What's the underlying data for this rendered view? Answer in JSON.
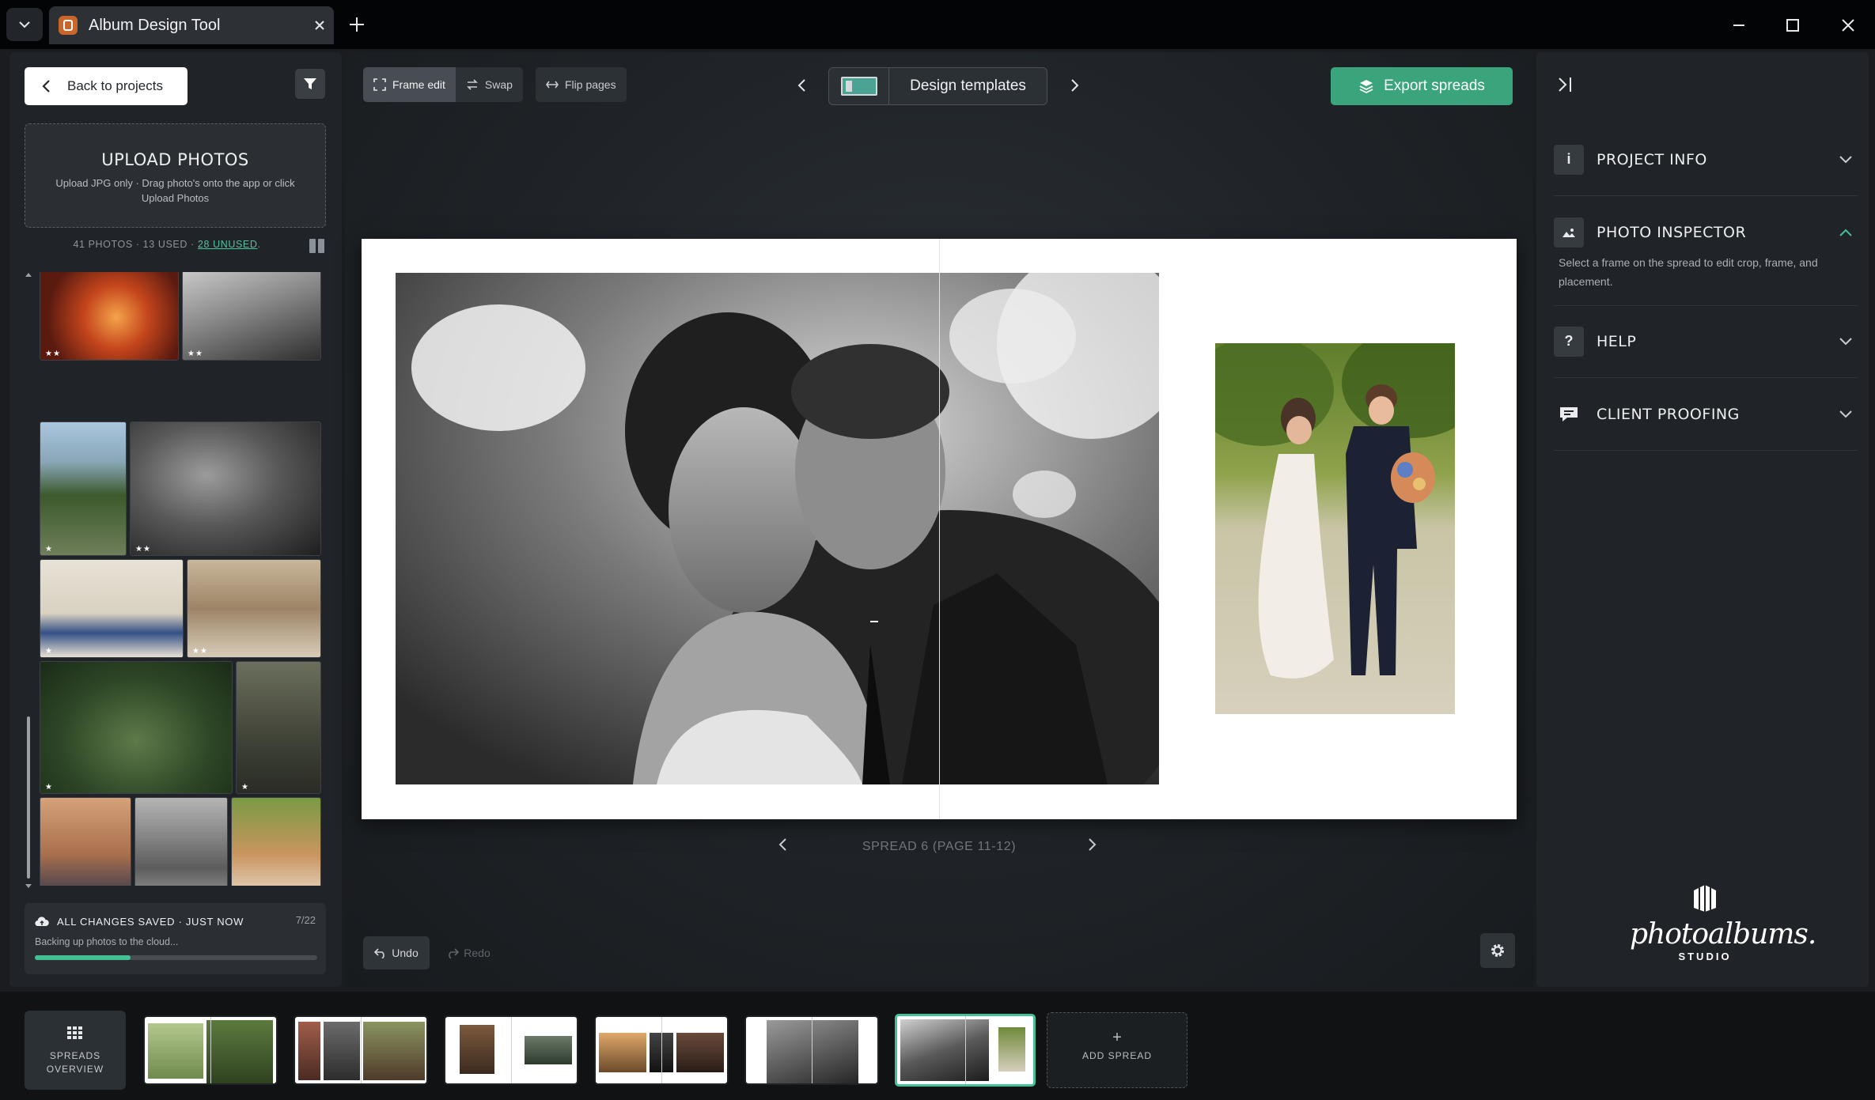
{
  "window": {
    "tab_title": "Album Design Tool"
  },
  "left_panel": {
    "back_label": "Back to projects",
    "upload_title": "UPLOAD PHOTOS",
    "upload_sub": "Upload JPG only · Drag photo's onto the app or click Upload Photos",
    "stats_prefix": "41 PHOTOS · 13 USED · ",
    "stats_unused": "28 UNUSED",
    "stats_suffix": ".",
    "save_title": "ALL CHANGES SAVED · JUST NOW",
    "save_count": "7/22",
    "save_sub": "Backing up photos to the cloud...",
    "save_progress": 0.34
  },
  "toolbar": {
    "frame_edit": "Frame edit",
    "swap": "Swap",
    "flip_pages": "Flip pages",
    "templates_label": "Design templates",
    "export_label": "Export spreads"
  },
  "canvas": {
    "spread_label": "SPREAD 6 (PAGE 11-12)",
    "undo_label": "Undo",
    "redo_label": "Redo"
  },
  "right_panel": {
    "sections": [
      {
        "label": "PROJECT INFO",
        "icon": "info-icon",
        "expanded": false
      },
      {
        "label": "PHOTO INSPECTOR",
        "icon": "image-icon",
        "expanded": true
      },
      {
        "label": "HELP",
        "icon": "question-icon",
        "expanded": false
      },
      {
        "label": "CLIENT PROOFING",
        "icon": "chat-icon",
        "expanded": false
      }
    ],
    "inspector_text": "Select a frame on the spread to edit crop, frame, and placement.",
    "brand_name": "photoalbums.",
    "brand_sub": "STUDIO"
  },
  "filmstrip": {
    "overview_label_1": "SPREADS",
    "overview_label_2": "OVERVIEW",
    "add_plus": "+",
    "add_label": "ADD SPREAD",
    "active_index": 5
  },
  "colors": {
    "accent": "#3aa57c",
    "accent_light": "#45c295",
    "panel_bg": "#202428",
    "titlebar_bg": "#030405"
  }
}
